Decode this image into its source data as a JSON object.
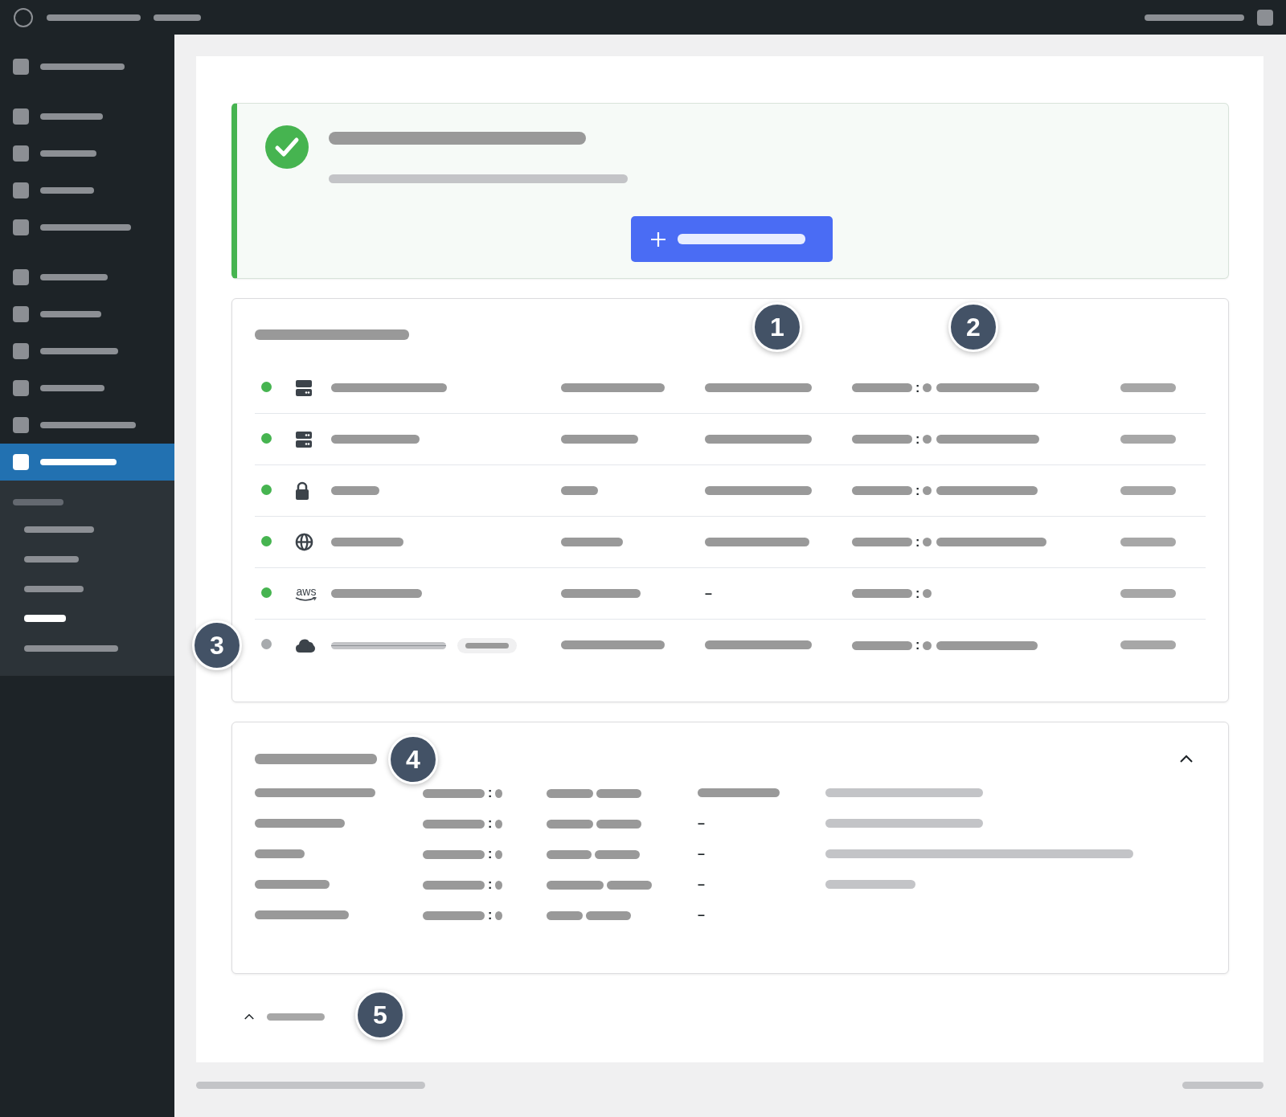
{
  "sidebar": {
    "items": [
      {
        "selected": false
      },
      {
        "selected": false
      },
      {
        "selected": false
      },
      {
        "selected": false
      },
      {
        "selected": false
      },
      {
        "selected": false
      },
      {
        "selected": false
      },
      {
        "selected": false
      },
      {
        "selected": false
      },
      {
        "selected": false
      },
      {
        "selected": true
      }
    ],
    "submenu": [
      {
        "selected": false
      },
      {
        "selected": false
      },
      {
        "selected": false
      },
      {
        "selected": false
      },
      {
        "selected": true
      },
      {
        "selected": false
      }
    ]
  },
  "notice": {
    "kind": "success"
  },
  "connections": {
    "rows": [
      {
        "color": "#46b450",
        "kind": "server",
        "disabled": false,
        "separator": ":"
      },
      {
        "color": "#46b450",
        "kind": "server",
        "disabled": false,
        "separator": ":"
      },
      {
        "color": "#46b450",
        "kind": "lock",
        "disabled": false,
        "separator": ":"
      },
      {
        "color": "#46b450",
        "kind": "globe",
        "disabled": false,
        "separator": ":"
      },
      {
        "color": "#46b450",
        "kind": "aws",
        "logo_text": "aws",
        "disabled": false,
        "column_3": "–",
        "separator": ":"
      },
      {
        "color": "#a7aaad",
        "kind": "cloud",
        "disabled": true,
        "separator": ":"
      }
    ]
  },
  "details": {
    "expanded": true,
    "rows": [
      {
        "separator": ":"
      },
      {
        "separator": ":",
        "column_4": "–"
      },
      {
        "separator": ":",
        "column_4": "–"
      },
      {
        "separator": ":",
        "column_4": "–"
      },
      {
        "separator": ":",
        "column_4": "–"
      }
    ]
  },
  "footer_toggle": {
    "expanded": true
  },
  "callouts": [
    {
      "label": "1"
    },
    {
      "label": "2"
    },
    {
      "label": "3"
    },
    {
      "label": "4"
    },
    {
      "label": "5"
    }
  ]
}
